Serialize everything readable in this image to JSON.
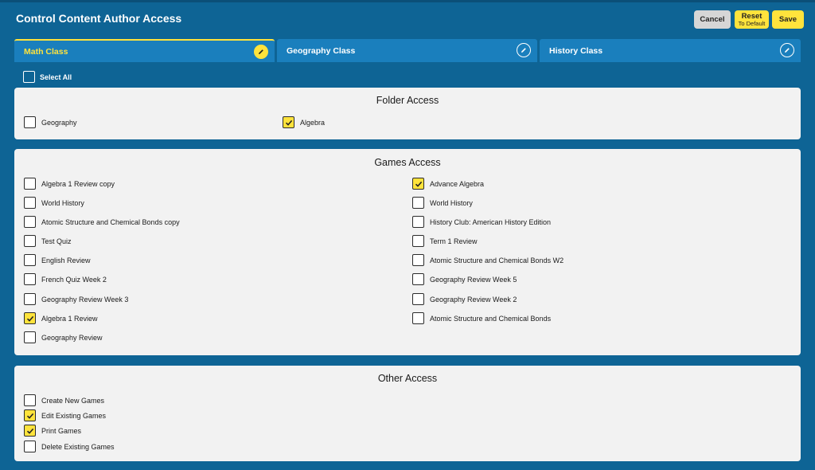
{
  "header": {
    "title": "Control Content Author Access",
    "cancel_label": "Cancel",
    "reset_label": "Reset",
    "reset_sub": "To Default",
    "save_label": "Save"
  },
  "tabs": [
    {
      "label": "Math Class",
      "active": true
    },
    {
      "label": "Geography Class",
      "active": false
    },
    {
      "label": "History Class",
      "active": false
    }
  ],
  "select_all": {
    "label": "Select All",
    "checked": false
  },
  "folder_access": {
    "title": "Folder Access",
    "items": [
      {
        "label": "Geography",
        "checked": false
      },
      {
        "label": "Algebra",
        "checked": true
      }
    ]
  },
  "games_access": {
    "title": "Games Access",
    "left": [
      {
        "label": "Algebra 1 Review copy",
        "checked": false
      },
      {
        "label": "World History",
        "checked": false
      },
      {
        "label": "Atomic Structure and Chemical Bonds copy",
        "checked": false
      },
      {
        "label": "Test Quiz",
        "checked": false
      },
      {
        "label": "English Review",
        "checked": false
      },
      {
        "label": "French Quiz Week 2",
        "checked": false
      },
      {
        "label": "Geography Review Week 3",
        "checked": false
      },
      {
        "label": "Algebra 1 Review",
        "checked": true
      },
      {
        "label": "Geography Review",
        "checked": false
      }
    ],
    "right": [
      {
        "label": "Advance Algebra",
        "checked": true
      },
      {
        "label": "World History",
        "checked": false
      },
      {
        "label": "History Club: American History Edition",
        "checked": false
      },
      {
        "label": "Term 1 Review",
        "checked": false
      },
      {
        "label": "Atomic Structure and Chemical Bonds W2",
        "checked": false
      },
      {
        "label": "Geography Review Week 5",
        "checked": false
      },
      {
        "label": "Geography Review Week 2",
        "checked": false
      },
      {
        "label": "Atomic Structure and Chemical Bonds",
        "checked": false
      }
    ]
  },
  "other_access": {
    "title": "Other Access",
    "items": [
      {
        "label": "Create New Games",
        "checked": false
      },
      {
        "label": "Edit Existing Games",
        "checked": true
      },
      {
        "label": "Print Games",
        "checked": true
      },
      {
        "label": "Delete Existing Games",
        "checked": false
      }
    ]
  },
  "colors": {
    "background": "#0e6495",
    "tab": "#1a7fbd",
    "accent": "#ffe33c",
    "panel": "#f2f2f2"
  }
}
